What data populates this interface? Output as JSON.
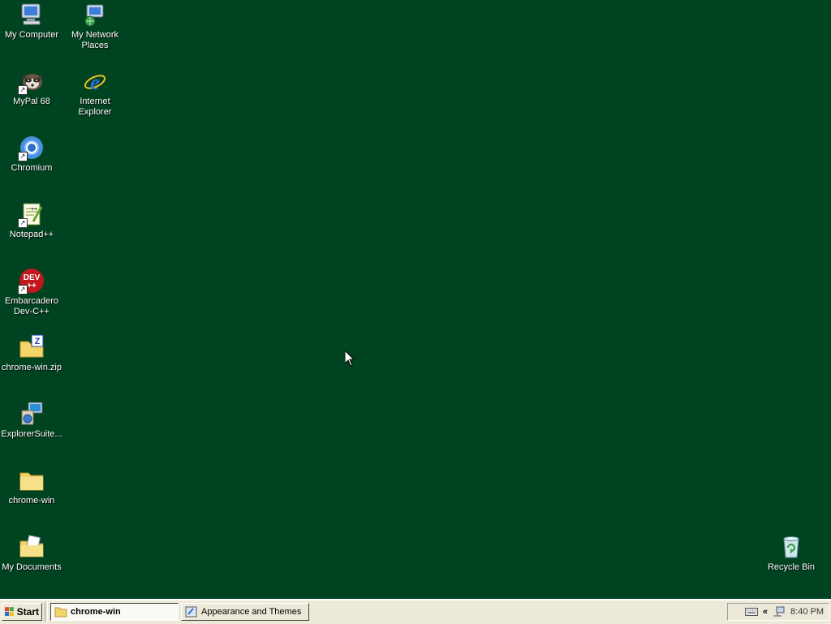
{
  "desktop": {
    "background": "#004321",
    "icons": {
      "my_computer": "My Computer",
      "my_network_places": "My Network\nPlaces",
      "mypal": "MyPal 68",
      "internet_explorer": "Internet\nExplorer",
      "chromium": "Chromium",
      "notepadpp": "Notepad++",
      "devcpp": "Embarcadero\nDev-C++",
      "chrome_zip": "chrome-win.zip",
      "explorer_suite": "ExplorerSuite...",
      "chrome_folder": "chrome-win",
      "my_documents": "My Documents",
      "recycle_bin": "Recycle Bin"
    }
  },
  "taskbar": {
    "start_label": "Start",
    "tasks": [
      {
        "label": "chrome-win",
        "icon": "folder-icon",
        "active": true
      },
      {
        "label": "Appearance and Themes",
        "icon": "control-panel-icon",
        "active": false
      }
    ],
    "tray": {
      "clock": "8:40 PM",
      "expand_glyph": "«"
    }
  }
}
